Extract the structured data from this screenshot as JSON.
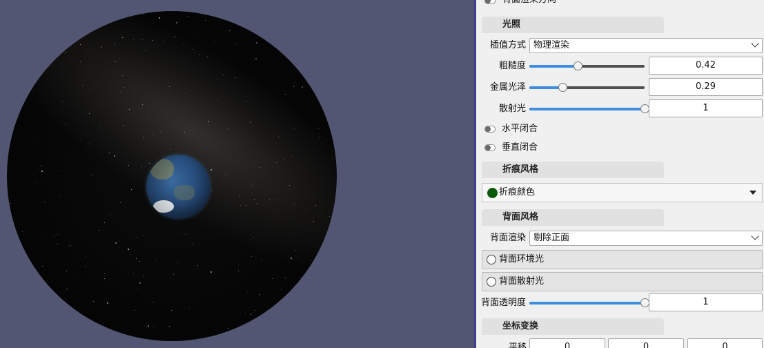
{
  "top_partial_label": "背面渲染方向",
  "lighting": {
    "header": "光照",
    "interp_label": "插值方式",
    "interp_value": "物理渲染",
    "roughness_label": "粗糙度",
    "roughness_value": "0.42",
    "metallic_label": "金属光泽",
    "metallic_value": "0.29",
    "diffuse_label": "散射光",
    "diffuse_value": "1",
    "horizontal_close_label": "水平闭合",
    "vertical_close_label": "垂直闭合"
  },
  "crease": {
    "header": "折痕风格",
    "color_label": "折痕颜色",
    "color": "#0b5a0b"
  },
  "backface": {
    "header": "背面风格",
    "render_label": "背面渲染",
    "render_value": "剔除正面",
    "ambient_label": "背面环境光",
    "diffuse_label": "背面散射光",
    "opacity_label": "背面透明度",
    "opacity_value": "1"
  },
  "transform": {
    "header": "坐标变换",
    "translate_label": "平移",
    "translate_x": "0",
    "translate_y": "0",
    "translate_z": "0"
  },
  "colors": {
    "viewport_bg": "#535672",
    "slider_fill": "#3d8ee0",
    "panel_bg": "#f0f0f0",
    "splitter": "#3e3f8f"
  }
}
